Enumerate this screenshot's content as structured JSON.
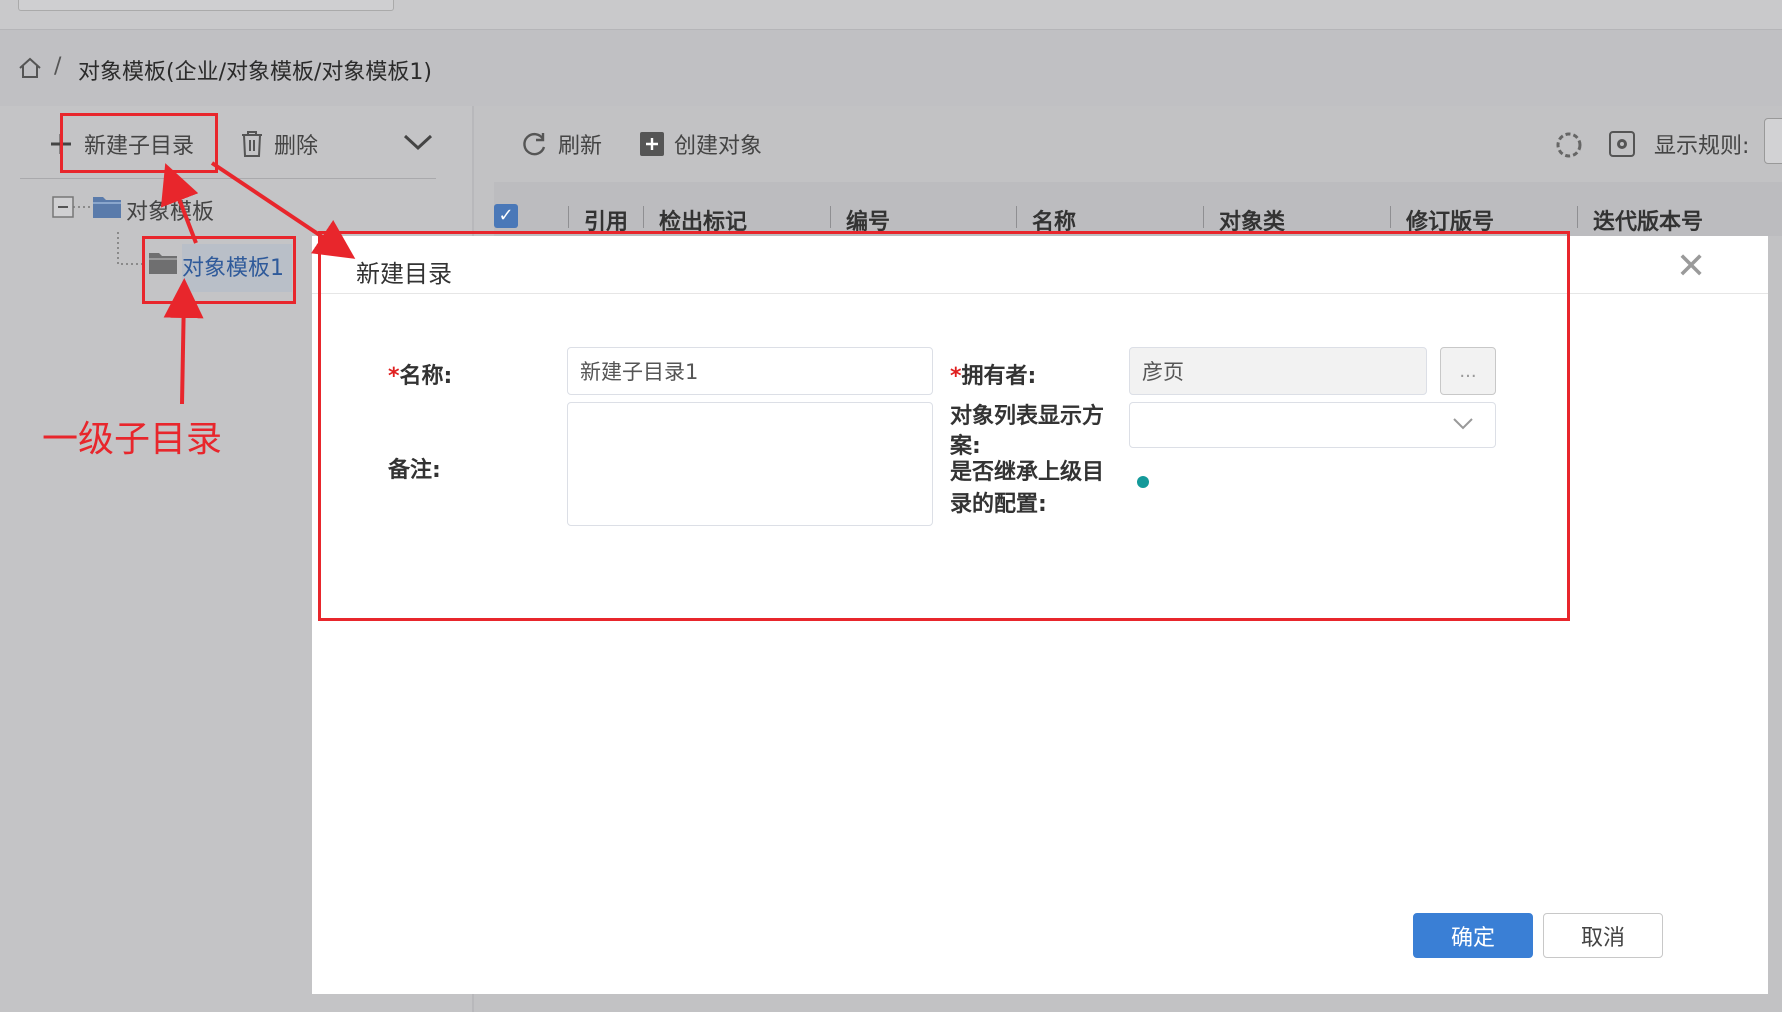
{
  "breadcrumb": {
    "separator": "/",
    "path": "对象模板(企业/对象模板/对象模板1)"
  },
  "left_toolbar": {
    "new_subdir": "新建子目录",
    "delete": "删除"
  },
  "tree": {
    "root": "对象模板",
    "child": "对象模板1"
  },
  "right_toolbar": {
    "refresh": "刷新",
    "create_object": "创建对象",
    "display_rule": "显示规则:"
  },
  "table": {
    "columns": [
      "引用",
      "检出标记",
      "编号",
      "名称",
      "对象类",
      "修订版号",
      "迭代版本号"
    ]
  },
  "dialog": {
    "title": "新建目录",
    "close": "✕",
    "required_mark": "*",
    "name_label": "名称:",
    "name_value": "新建子目录1",
    "remark_label": "备注:",
    "owner_label": "拥有者:",
    "owner_value": "彦页",
    "owner_picker": "...",
    "list_scheme_label_1": "对象列表显示方",
    "list_scheme_label_2": "案:",
    "inherit_label_1": "是否继承上级目",
    "inherit_label_2": "录的配置:",
    "confirm": "确定",
    "cancel": "取消"
  },
  "annotation": {
    "text": "一级子目录"
  },
  "colors": {
    "accent": "#3a7fd5",
    "annotation": "#e8262c",
    "toggle": "#149a9a"
  }
}
